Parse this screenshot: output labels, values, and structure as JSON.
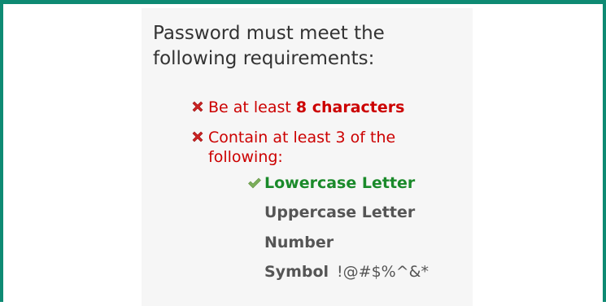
{
  "colors": {
    "frame_border": "#0e8a73",
    "panel_background": "#f6f6f6",
    "unmet_red": "#cc0000",
    "met_green": "#1a8a2a",
    "neutral_gray": "#555555"
  },
  "requirements": {
    "heading_line1": "Password must meet the",
    "heading_line2": "following requirements:",
    "items": [
      {
        "status": "unmet",
        "icon": "x-icon",
        "prefix": "Be at least ",
        "emphasis": "8 characters"
      },
      {
        "status": "unmet",
        "icon": "x-icon",
        "line1": "Contain at least 3 of the",
        "line2": "following:"
      }
    ],
    "sub_items": [
      {
        "label": "Lowercase Letter",
        "status": "met",
        "icon": "check-icon"
      },
      {
        "label": "Uppercase Letter",
        "status": "neutral"
      },
      {
        "label": "Number",
        "status": "neutral"
      },
      {
        "label": "Symbol",
        "status": "neutral",
        "extra": "!@#$%^&*"
      }
    ]
  }
}
